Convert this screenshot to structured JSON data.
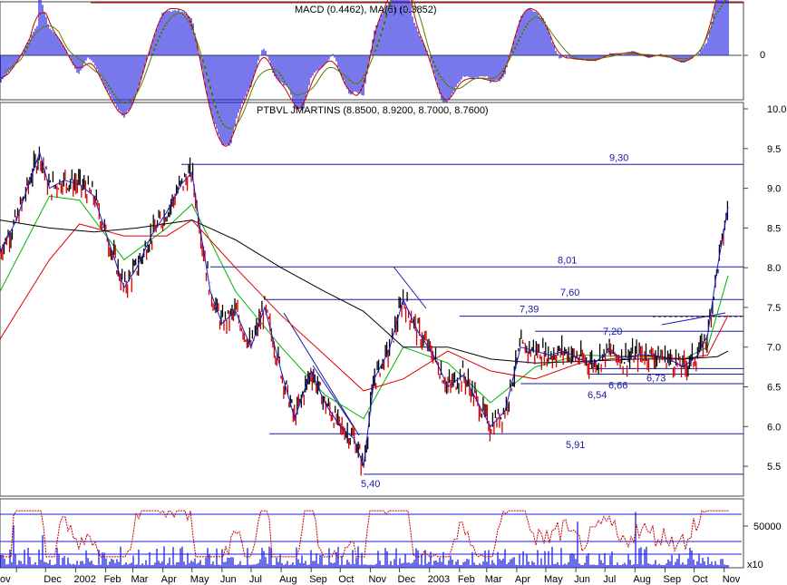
{
  "chart_data": [
    {
      "panel": "macd",
      "type": "bar",
      "title": "MACD (0.4462), MA(5) (0.3852)",
      "yticks": [
        "0"
      ],
      "colors": {
        "histogram": "#1e1ee0",
        "macd_line": "#c00000",
        "signal_line": "#5a7a00"
      }
    },
    {
      "panel": "price",
      "type": "line",
      "title": "PTBVL JMARTINS (8.8500, 8.9200, 8.7000, 8.7600)",
      "ylim": [
        5.25,
        10.0
      ],
      "yticks": [
        "5.5",
        "6.0",
        "6.5",
        "7.0",
        "7.5",
        "8.0",
        "8.5",
        "9.0",
        "9.5",
        "10.0"
      ],
      "price_series": [
        [
          "2001-10-15",
          8.2
        ],
        [
          "2001-11-01",
          8.6
        ],
        [
          "2001-11-15",
          9.1
        ],
        [
          "2001-11-25",
          9.45
        ],
        [
          "2001-12-05",
          9.0
        ],
        [
          "2001-12-20",
          9.1
        ],
        [
          "2002-01-05",
          9.05
        ],
        [
          "2002-01-20",
          8.9
        ],
        [
          "2002-02-05",
          8.3
        ],
        [
          "2002-02-20",
          7.75
        ],
        [
          "2002-03-05",
          8.0
        ],
        [
          "2002-03-20",
          8.4
        ],
        [
          "2002-04-05",
          8.7
        ],
        [
          "2002-04-20",
          9.05
        ],
        [
          "2002-05-01",
          9.2
        ],
        [
          "2002-05-10",
          8.45
        ],
        [
          "2002-05-20",
          7.7
        ],
        [
          "2002-06-01",
          7.3
        ],
        [
          "2002-06-15",
          7.45
        ],
        [
          "2002-07-01",
          7.0
        ],
        [
          "2002-07-15",
          7.5
        ],
        [
          "2002-08-01",
          6.7
        ],
        [
          "2002-08-15",
          6.1
        ],
        [
          "2002-09-01",
          6.7
        ],
        [
          "2002-09-15",
          6.3
        ],
        [
          "2002-10-01",
          6.0
        ],
        [
          "2002-10-15",
          5.85
        ],
        [
          "2002-10-25",
          5.5
        ],
        [
          "2002-11-05",
          6.6
        ],
        [
          "2002-11-20",
          6.95
        ],
        [
          "2002-12-05",
          7.6
        ],
        [
          "2002-12-20",
          7.2
        ],
        [
          "2003-01-05",
          6.9
        ],
        [
          "2003-01-20",
          6.5
        ],
        [
          "2003-02-05",
          6.65
        ],
        [
          "2003-02-20",
          6.3
        ],
        [
          "2003-03-05",
          6.0
        ],
        [
          "2003-03-20",
          6.2
        ],
        [
          "2003-04-05",
          7.0
        ],
        [
          "2003-04-20",
          6.95
        ],
        [
          "2003-05-05",
          6.9
        ],
        [
          "2003-05-20",
          6.95
        ],
        [
          "2003-06-05",
          6.85
        ],
        [
          "2003-06-20",
          6.8
        ],
        [
          "2003-07-05",
          6.95
        ],
        [
          "2003-07-20",
          6.85
        ],
        [
          "2003-08-05",
          6.9
        ],
        [
          "2003-08-20",
          6.9
        ],
        [
          "2003-09-05",
          6.85
        ],
        [
          "2003-09-20",
          6.75
        ],
        [
          "2003-10-05",
          6.9
        ],
        [
          "2003-10-15",
          7.15
        ],
        [
          "2003-10-25",
          8.0
        ],
        [
          "2003-11-05",
          8.76
        ]
      ],
      "moving_averages": [
        {
          "color": "#00b000",
          "values": [
            [
              "2001-10-15",
              7.7
            ],
            [
              "2001-12-05",
              8.9
            ],
            [
              "2002-01-05",
              8.85
            ],
            [
              "2002-02-20",
              8.1
            ],
            [
              "2002-04-05",
              8.5
            ],
            [
              "2002-05-01",
              8.8
            ],
            [
              "2002-06-15",
              7.7
            ],
            [
              "2002-08-01",
              7.0
            ],
            [
              "2002-09-15",
              6.4
            ],
            [
              "2002-10-25",
              6.1
            ],
            [
              "2002-12-05",
              7.0
            ],
            [
              "2003-01-20",
              6.8
            ],
            [
              "2003-03-05",
              6.3
            ],
            [
              "2003-04-20",
              6.75
            ],
            [
              "2003-06-05",
              6.9
            ],
            [
              "2003-08-05",
              6.88
            ],
            [
              "2003-09-20",
              6.85
            ],
            [
              "2003-10-15",
              7.0
            ],
            [
              "2003-11-05",
              7.9
            ]
          ]
        },
        {
          "color": "#e00000",
          "values": [
            [
              "2001-10-15",
              7.1
            ],
            [
              "2001-12-05",
              8.1
            ],
            [
              "2002-01-05",
              8.55
            ],
            [
              "2002-02-20",
              8.4
            ],
            [
              "2002-04-05",
              8.4
            ],
            [
              "2002-05-01",
              8.6
            ],
            [
              "2002-06-15",
              8.0
            ],
            [
              "2002-08-01",
              7.4
            ],
            [
              "2002-09-15",
              6.9
            ],
            [
              "2002-10-25",
              6.45
            ],
            [
              "2002-12-05",
              6.6
            ],
            [
              "2003-01-20",
              6.95
            ],
            [
              "2003-03-05",
              6.7
            ],
            [
              "2003-04-20",
              6.6
            ],
            [
              "2003-06-05",
              6.8
            ],
            [
              "2003-08-05",
              6.9
            ],
            [
              "2003-09-20",
              6.85
            ],
            [
              "2003-10-15",
              6.9
            ],
            [
              "2003-11-05",
              7.4
            ]
          ]
        },
        {
          "color": "#000000",
          "values": [
            [
              "2001-10-15",
              8.6
            ],
            [
              "2001-12-05",
              8.5
            ],
            [
              "2002-01-20",
              8.45
            ],
            [
              "2002-03-05",
              8.5
            ],
            [
              "2002-05-01",
              8.6
            ],
            [
              "2002-06-15",
              8.35
            ],
            [
              "2002-08-01",
              8.0
            ],
            [
              "2002-09-15",
              7.7
            ],
            [
              "2002-10-25",
              7.45
            ],
            [
              "2002-12-05",
              7.0
            ],
            [
              "2003-01-20",
              7.0
            ],
            [
              "2003-03-05",
              6.85
            ],
            [
              "2003-04-20",
              6.8
            ],
            [
              "2003-06-05",
              6.82
            ],
            [
              "2003-08-05",
              6.85
            ],
            [
              "2003-09-20",
              6.85
            ],
            [
              "2003-10-25",
              6.88
            ],
            [
              "2003-11-05",
              6.95
            ]
          ]
        }
      ],
      "support_resistance": [
        {
          "label": "9,30",
          "value": 9.3,
          "from": "2002-04-20"
        },
        {
          "label": "8,01",
          "value": 8.01,
          "from": "2002-05-20"
        },
        {
          "label": "7,60",
          "value": 7.6,
          "from": "2002-07-15"
        },
        {
          "label": "7,39",
          "value": 7.39,
          "from": "2003-02-01"
        },
        {
          "label": "7,20",
          "value": 7.2,
          "from": "2003-04-20"
        },
        {
          "label": "6,73",
          "value": 6.73,
          "from": "2003-06-15"
        },
        {
          "label": "6,66",
          "value": 6.66,
          "from": "2003-06-15"
        },
        {
          "label": "6,54",
          "value": 6.54,
          "from": "2003-04-05"
        },
        {
          "label": "5,91",
          "value": 5.91,
          "from": "2002-07-20"
        },
        {
          "label": "5,40",
          "value": 5.4,
          "from": "2002-10-25"
        }
      ]
    },
    {
      "panel": "volume",
      "type": "bar",
      "yticks": [
        "50000"
      ],
      "multiplier_label": "x10",
      "colors": {
        "bars": "#1e1ee0",
        "oscillator": "#c00000",
        "bands": "#1e1ee0"
      }
    }
  ],
  "x_axis": {
    "tick_labels": [
      "ov",
      "Dec",
      "2002",
      "Feb",
      "Mar",
      "Apr",
      "May",
      "Jun",
      "Jul",
      "Aug",
      "Sep",
      "Oct",
      "Nov",
      "Dec",
      "2003",
      "Feb",
      "Mar",
      "Apr",
      "May",
      "Jun",
      "Jul",
      "Aug",
      "Sep",
      "Oct",
      "Nov"
    ]
  }
}
